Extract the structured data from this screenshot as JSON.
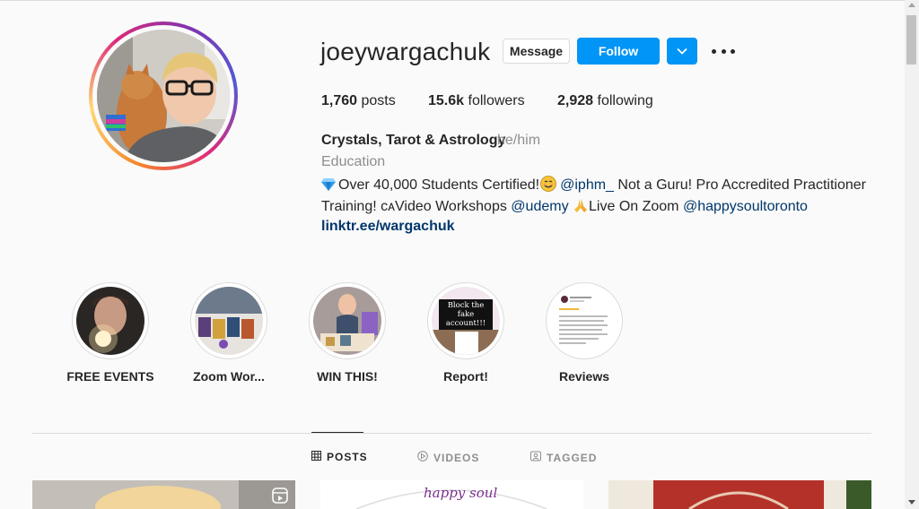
{
  "profile": {
    "username": "joeywargachuk",
    "message_label": "Message",
    "follow_label": "Follow",
    "posts_count": "1,760",
    "posts_label": "posts",
    "followers_count": "15.6k",
    "followers_label": "followers",
    "following_count": "2,928",
    "following_label": "following",
    "full_name": "Crystals, Tarot & Astrology",
    "pronouns": "he/him",
    "category": "Education",
    "bio_line1_pre": "Over 40,000 Students Certified!",
    "bio_line1_mention": "@iphm_",
    "bio_line1_post": " Not a Guru! Pro Accredited Practitioner",
    "bio_line2_pre": "Training! ᴄᴀVideo Workshops ",
    "bio_line2_mention1": "@udemy",
    "bio_line2_mid": "Live On Zoom ",
    "bio_line2_mention2": "@happysoultoronto",
    "website": "linktr.ee/wargachuk"
  },
  "highlights": [
    {
      "label": "FREE EVENTS"
    },
    {
      "label": "Zoom Wor..."
    },
    {
      "label": "WIN THIS!"
    },
    {
      "label": "Report!"
    },
    {
      "label": "Reviews"
    }
  ],
  "highlight_text": {
    "report_main": "Block the fake account!!!"
  },
  "tabs": [
    {
      "label": "POSTS",
      "icon": "grid-icon",
      "active": true
    },
    {
      "label": "VIDEOS",
      "icon": "play-circle-icon",
      "active": false
    },
    {
      "label": "TAGGED",
      "icon": "tag-portrait-icon",
      "active": false
    }
  ],
  "posts_preview": {
    "post2_logo": "happy soul"
  },
  "colors": {
    "accent": "#0095f6",
    "link": "#00376b",
    "muted": "#8e8e8e",
    "text": "#262626"
  }
}
